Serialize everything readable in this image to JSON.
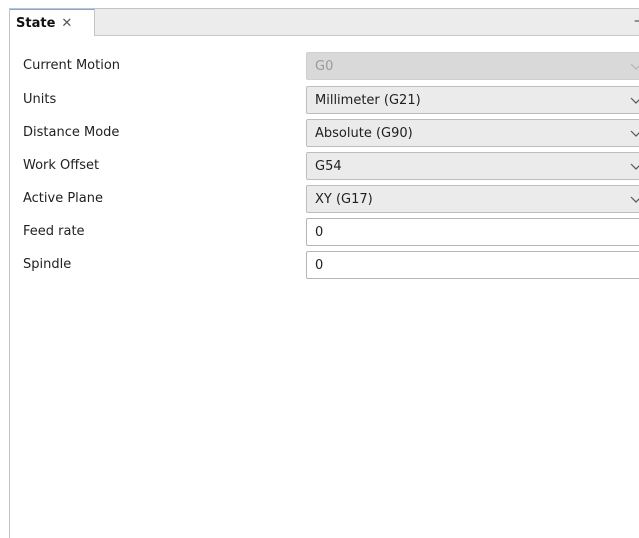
{
  "tab": {
    "title": "State",
    "close_glyph": "✕",
    "minimize_glyph": "–"
  },
  "fields": [
    {
      "label": "Current Motion",
      "type": "select",
      "value": "G0",
      "disabled": true
    },
    {
      "label": "Units",
      "type": "select",
      "value": "Millimeter (G21)",
      "disabled": false
    },
    {
      "label": "Distance Mode",
      "type": "select",
      "value": "Absolute (G90)",
      "disabled": false
    },
    {
      "label": "Work Offset",
      "type": "select",
      "value": "G54",
      "disabled": false
    },
    {
      "label": "Active Plane",
      "type": "select",
      "value": "XY (G17)",
      "disabled": false
    },
    {
      "label": "Feed rate",
      "type": "input",
      "value": "0"
    },
    {
      "label": "Spindle",
      "type": "input",
      "value": "0"
    }
  ],
  "icons": {
    "close": "close-icon",
    "minimize": "minimize-icon",
    "dropdown": "chevron-down-icon"
  }
}
